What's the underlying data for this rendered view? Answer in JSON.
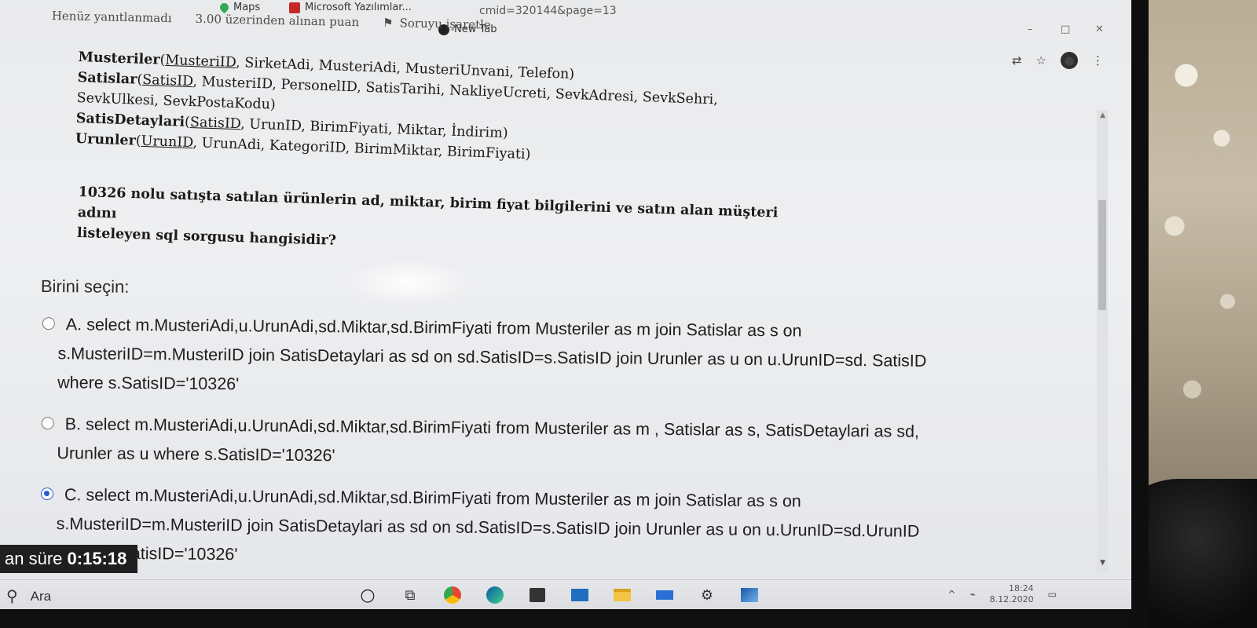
{
  "browser": {
    "url_fragment": "cmid=320144&page=13",
    "bookmarks": [
      {
        "label": "Maps",
        "color": "#34a853"
      },
      {
        "label": "Microsoft Yazılımlar...",
        "color": "#c62828"
      },
      {
        "label": "New Tab",
        "color": "#222222"
      }
    ],
    "window_controls": {
      "minimize": "–",
      "maximize": "□",
      "close": "✕"
    },
    "toolbar": {
      "translate": "⇄",
      "star": "☆",
      "menu": "⋮",
      "avatar": "●"
    }
  },
  "question_info": {
    "status": "Henüz yanıtlanmadı",
    "points": "3.00 üzerinden alınan puan",
    "flag_label": "Soruyu işaretle"
  },
  "schema": {
    "tables": [
      {
        "name": "Musteriler",
        "pk": "MusteriID",
        "rest": ", SirketAdi, MusteriAdi, MusteriUnvani, Telefon)"
      },
      {
        "name": "Satislar",
        "pk": "SatisID",
        "rest": ", MusteriID, PersonelID, SatisTarihi, NakliyeUcreti, SevkAdresi, SevkSehri,"
      },
      {
        "name": "",
        "pk": "",
        "rest": "SevkUlkesi, SevkPostaKodu)"
      },
      {
        "name": "SatisDetaylari",
        "pk": "SatisID",
        "rest": ", UrunID, BirimFiyati, Miktar, İndirim)"
      },
      {
        "name": "Urunler",
        "pk": "UrunID",
        "rest": ", UrunAdi, KategoriID, BirimMiktar, BirimFiyati)"
      }
    ]
  },
  "question": {
    "line1": "10326 nolu satışta satılan ürünlerin ad, miktar, birim fiyat bilgilerini ve satın alan müşteri adını",
    "line2": "listeleyen sql sorgusu hangisidir?"
  },
  "choose_label": "Birini seçin:",
  "options": [
    {
      "line1": "A. select m.MusteriAdi,u.UrunAdi,sd.Miktar,sd.BirimFiyati from Musteriler as m  join Satislar as s on",
      "line2": "s.MusteriID=m.MusteriID  join SatisDetaylari as sd on sd.SatisID=s.SatisID  join Urunler as u on u.UrunID=sd. SatisID",
      "line3": "where s.SatisID='10326'",
      "selected": false
    },
    {
      "line1": "B. select m.MusteriAdi,u.UrunAdi,sd.Miktar,sd.BirimFiyati from Musteriler as m , Satislar as s, SatisDetaylari as sd,",
      "line2": "Urunler as u where s.SatisID='10326'",
      "line3": "",
      "selected": false
    },
    {
      "line1": "C. select m.MusteriAdi,u.UrunAdi,sd.Miktar,sd.BirimFiyati from Musteriler as m  join Satislar as s on",
      "line2": "s.MusteriID=m.MusteriID  join SatisDetaylari as sd on sd.SatisID=s.SatisID  join Urunler as u on u.UrunID=sd.UrunID",
      "line3": "where s.SatisID='10326'",
      "selected": true
    }
  ],
  "timer": {
    "label": "an süre",
    "value": "0:15:18"
  },
  "taskbar": {
    "search_label": "Ara",
    "time": "18:24",
    "date": "8.12.2020"
  }
}
